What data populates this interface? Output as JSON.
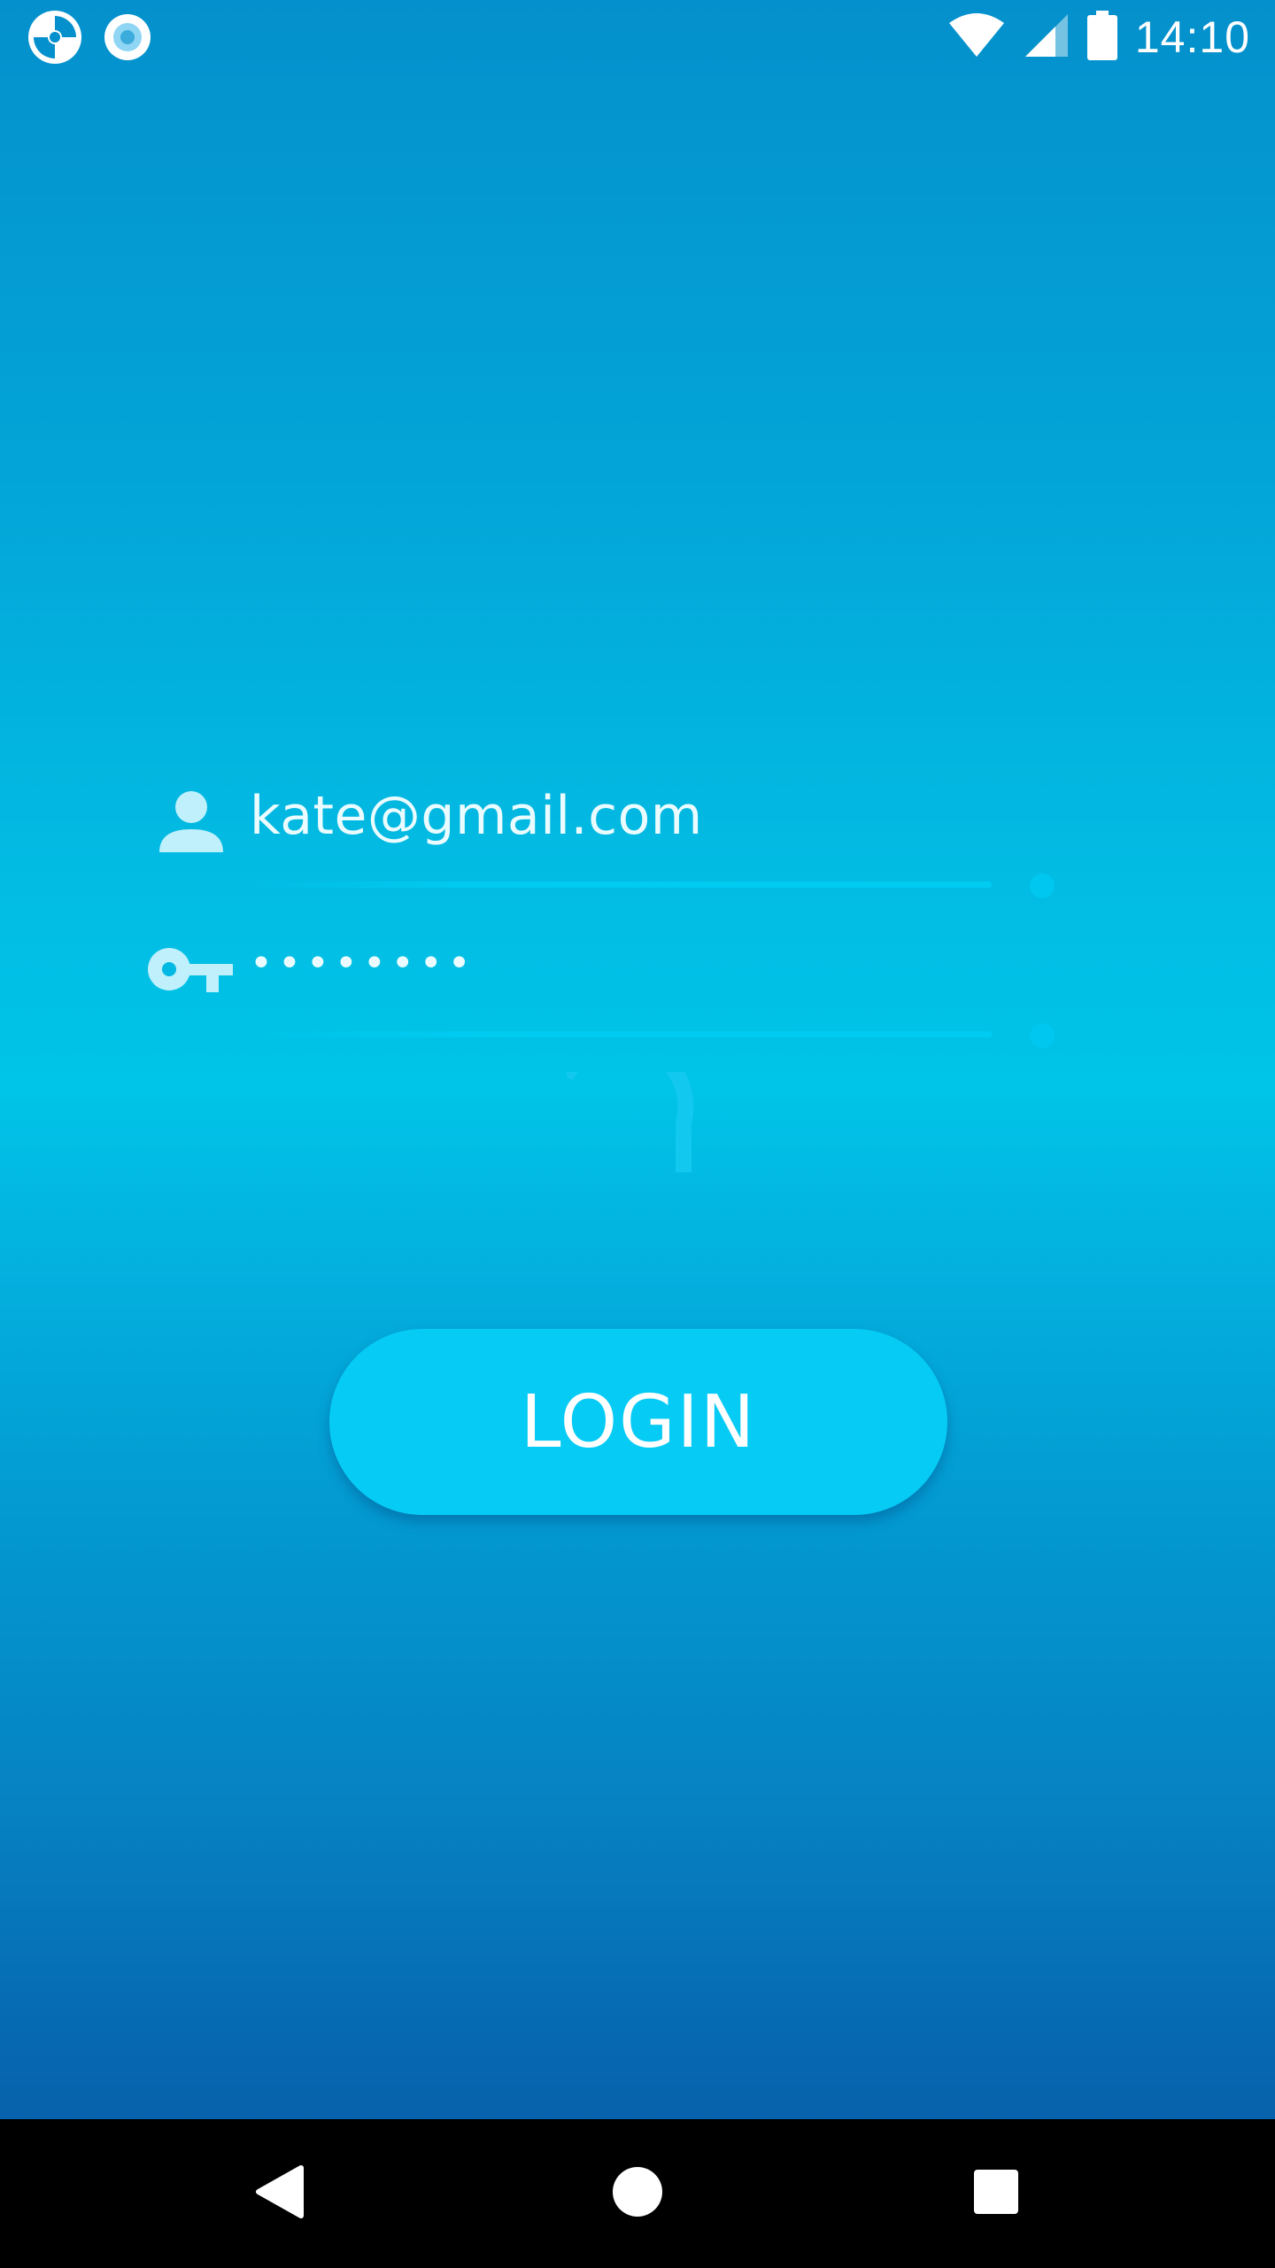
{
  "status_bar": {
    "time": "14:10",
    "left_icons": [
      "app-notification-icon",
      "record-notification-icon"
    ],
    "right_icons": [
      "wifi-icon",
      "cell-signal-icon",
      "battery-icon"
    ]
  },
  "login_form": {
    "email": {
      "icon": "person-icon",
      "value": "kate@gmail.com"
    },
    "password": {
      "icon": "key-icon",
      "value": "••••••••"
    },
    "loading_indicator": "spinner-icon",
    "login_button_label": "LOGIN"
  },
  "nav_bar": {
    "buttons": [
      "back-icon",
      "home-icon",
      "recents-icon"
    ]
  },
  "colors": {
    "gradient_top": "#0490cc",
    "gradient_mid": "#00c4e8",
    "gradient_bottom": "#0557a3",
    "accent": "#06cbf5",
    "nav_bar": "#000000",
    "text": "#ffffff"
  }
}
